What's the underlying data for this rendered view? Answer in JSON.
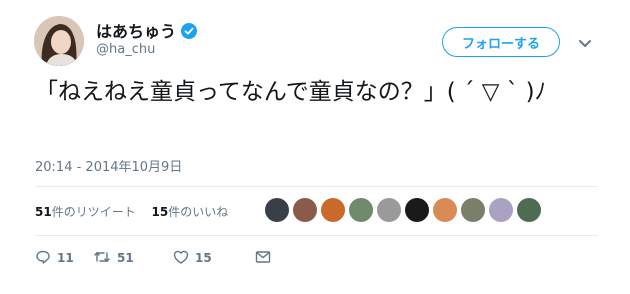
{
  "user": {
    "display_name": "はあちゅう",
    "handle": "@ha_chu",
    "verified": true
  },
  "follow_button_label": "フォローする",
  "tweet": {
    "text": "「ねえねえ童貞ってなんで童貞なの？」( ´ ▽ ` )ﾉ",
    "timestamp": "20:14 - 2014年10月9日"
  },
  "stats": {
    "retweets_count": "51",
    "retweets_label": "件のリツイート",
    "likes_count": "15",
    "likes_label": "件のいいね"
  },
  "likers_count_visible": 10,
  "actions": {
    "reply_count": "11",
    "retweet_count": "51",
    "like_count": "15"
  },
  "colors": {
    "accent": "#1da1f2",
    "muted": "#657786",
    "text": "#14171a"
  }
}
